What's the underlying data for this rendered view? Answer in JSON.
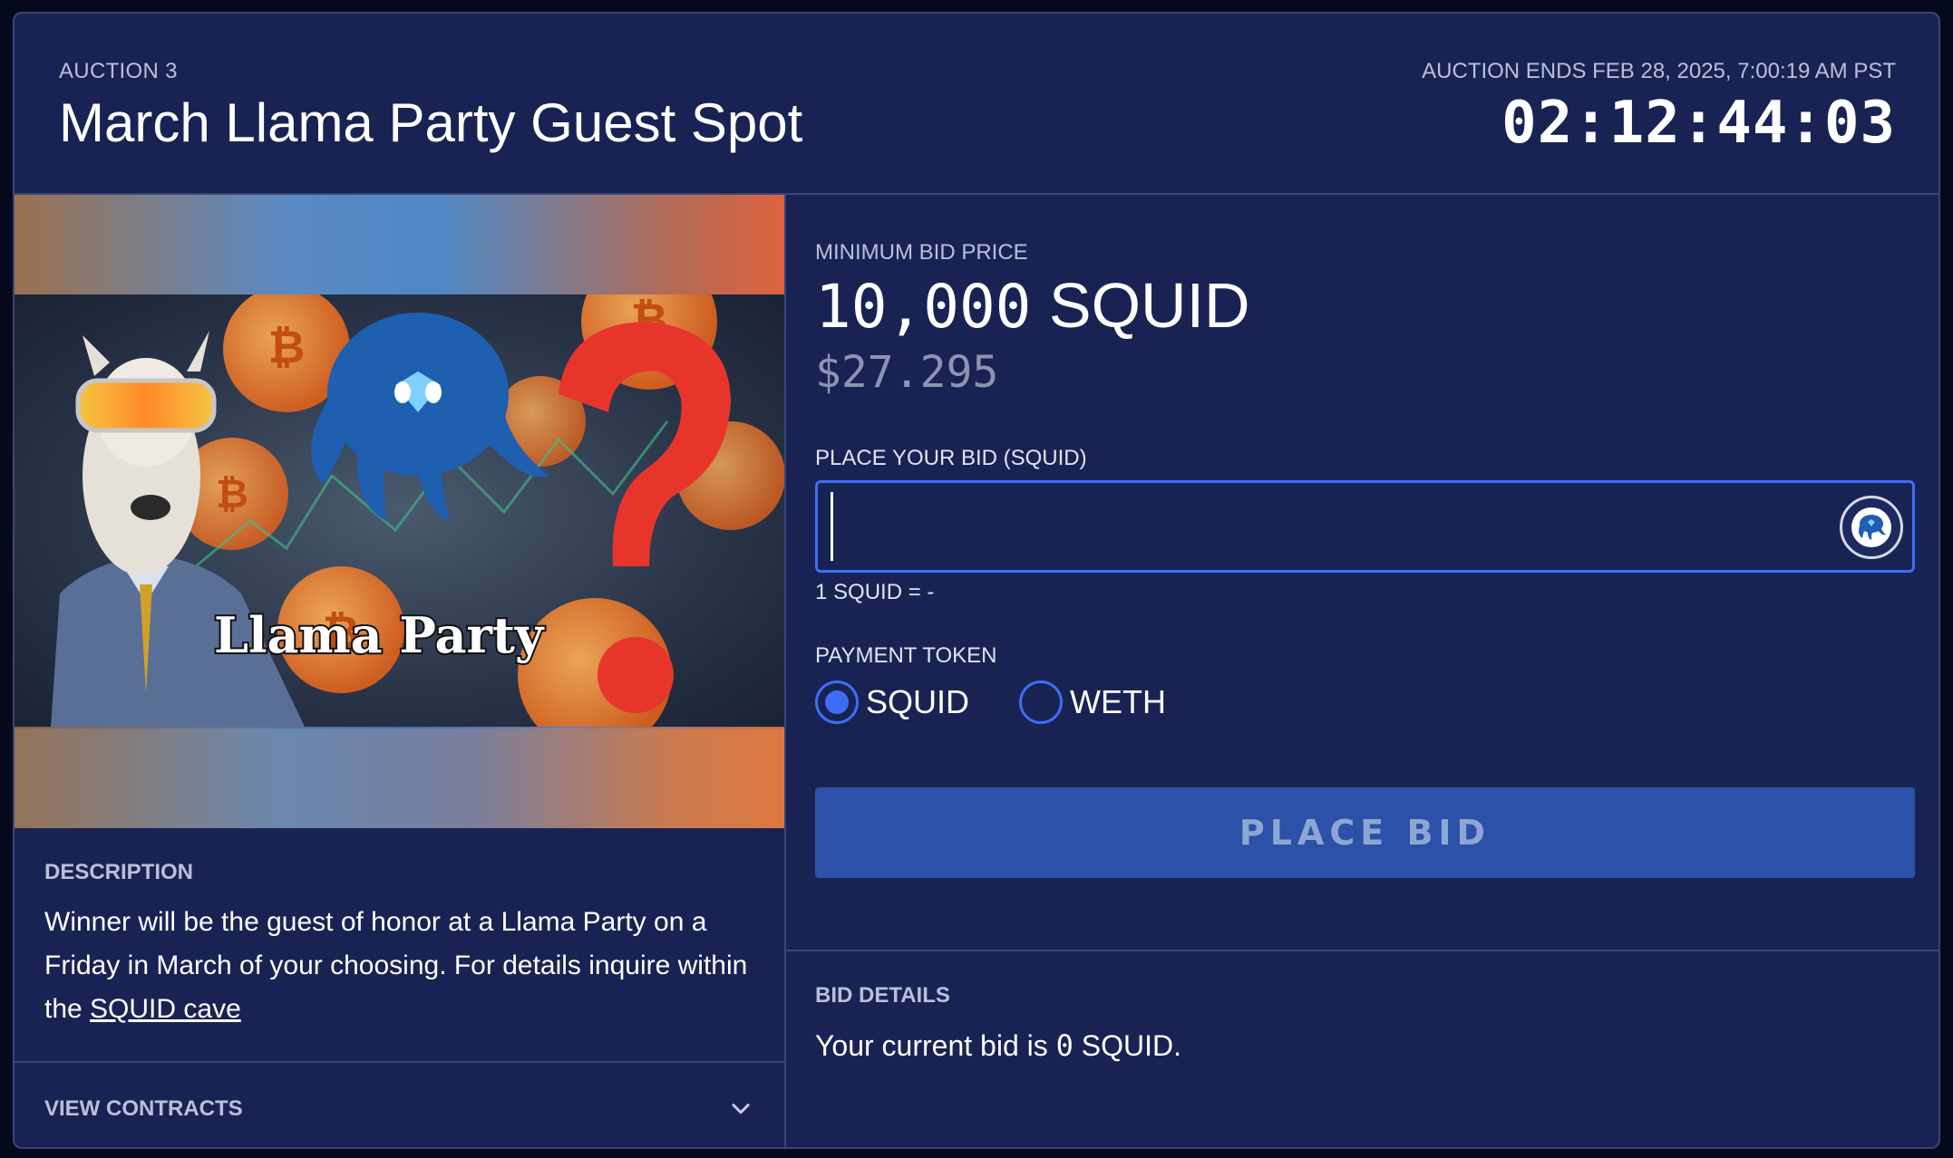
{
  "header": {
    "auction_label": "AUCTION 3",
    "title": "March Llama Party Guest Spot",
    "ends_label": "AUCTION ENDS FEB 28, 2025, 7:00:19 AM PST",
    "countdown": "02:12:44:03"
  },
  "image": {
    "caption_text": "Llama Party",
    "icons": [
      "llama-icon",
      "squid-logo-icon",
      "question-mark-icon",
      "bitcoin-coin-icon"
    ]
  },
  "description": {
    "heading": "DESCRIPTION",
    "text_before_link": "Winner will be the guest of honor at a Llama Party on a Friday in March of your choosing. For details inquire within the ",
    "link_text": "SQUID cave"
  },
  "contracts": {
    "label": "VIEW CONTRACTS",
    "icon": "chevron-down-icon"
  },
  "bid": {
    "min_label": "MINIMUM BID PRICE",
    "min_amount": "10,000",
    "min_token": "SQUID",
    "min_usd": "$27.295",
    "input_label": "PLACE YOUR BID (SQUID)",
    "input_value": "",
    "rate": "1 SQUID = -",
    "payment_label": "PAYMENT TOKEN",
    "tokens": [
      {
        "label": "SQUID",
        "selected": true
      },
      {
        "label": "WETH",
        "selected": false
      }
    ],
    "button_label": "PLACE BID"
  },
  "details": {
    "heading": "BID DETAILS",
    "text_before": "Your current bid is ",
    "amount": "0",
    "text_after": " SQUID."
  },
  "colors": {
    "background": "#192353",
    "accent": "#3e6df5",
    "button": "#2b52a8",
    "muted_text": "#b8c0da"
  }
}
